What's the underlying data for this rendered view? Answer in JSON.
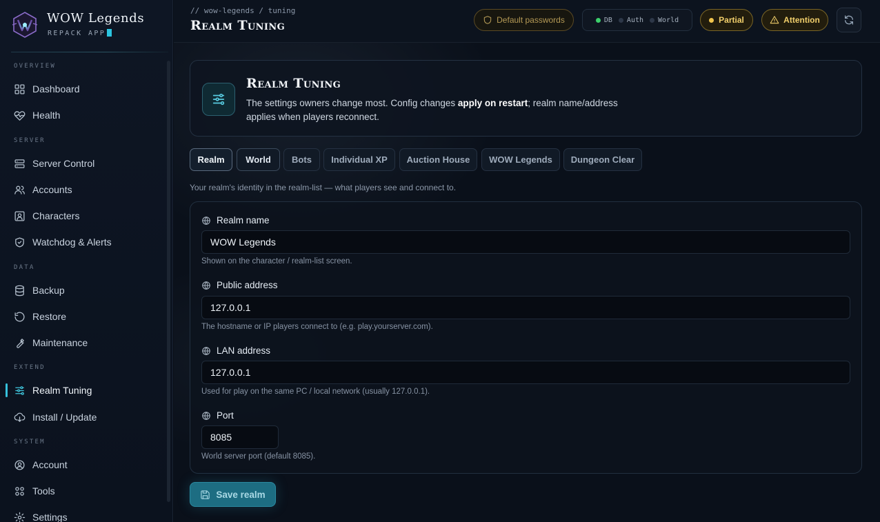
{
  "brand": {
    "title": "WOW Legends",
    "subtitle": "REPACK APP"
  },
  "sidebar": {
    "sections": [
      {
        "label": "OVERVIEW"
      },
      {
        "label": "SERVER"
      },
      {
        "label": "DATA"
      },
      {
        "label": "EXTEND"
      },
      {
        "label": "SYSTEM"
      }
    ],
    "items": [
      {
        "label": "Dashboard",
        "icon": "dashboard-icon"
      },
      {
        "label": "Health",
        "icon": "heart-pulse-icon"
      },
      {
        "label": "Server Control",
        "icon": "server-icon"
      },
      {
        "label": "Accounts",
        "icon": "users-icon"
      },
      {
        "label": "Characters",
        "icon": "character-icon"
      },
      {
        "label": "Watchdog & Alerts",
        "icon": "shield-check-icon"
      },
      {
        "label": "Backup",
        "icon": "database-icon"
      },
      {
        "label": "Restore",
        "icon": "restore-icon"
      },
      {
        "label": "Maintenance",
        "icon": "wrench-icon"
      },
      {
        "label": "Realm Tuning",
        "icon": "sliders-icon",
        "active": true
      },
      {
        "label": "Install / Update",
        "icon": "install-icon"
      },
      {
        "label": "Account",
        "icon": "user-circle-icon"
      },
      {
        "label": "Tools",
        "icon": "tools-icon"
      },
      {
        "label": "Settings",
        "icon": "gear-icon"
      }
    ]
  },
  "topbar": {
    "breadcrumb": "// wow-legends / tuning",
    "title": "Realm Tuning",
    "default_passwords": "Default passwords",
    "status": {
      "db": "DB",
      "auth": "Auth",
      "world": "World"
    },
    "partial": "Partial",
    "attention": "Attention"
  },
  "hero": {
    "title": "Realm Tuning",
    "desc_before": "The settings owners change most. Config changes ",
    "desc_bold": "apply on restart",
    "desc_after": "; realm name/address applies when players reconnect."
  },
  "tabs": [
    "Realm",
    "World",
    "Bots",
    "Individual XP",
    "Auction House",
    "WOW Legends",
    "Dungeon Clear"
  ],
  "tab_hint": "Your realm's identity in the realm-list — what players see and connect to.",
  "form": {
    "realm_name": {
      "label": "Realm name",
      "value": "WOW Legends",
      "help": "Shown on the character / realm-list screen."
    },
    "public_address": {
      "label": "Public address",
      "value": "127.0.0.1",
      "help": "The hostname or IP players connect to (e.g. play.yourserver.com)."
    },
    "lan_address": {
      "label": "LAN address",
      "value": "127.0.0.1",
      "help": "Used for play on the same PC / local network (usually 127.0.0.1)."
    },
    "port": {
      "label": "Port",
      "value": "8085",
      "help": "World server port (default 8085)."
    }
  },
  "save_label": "Save realm",
  "colors": {
    "accent": "#36c2dc",
    "warning": "#f1cf6b",
    "ok": "#3ccf6b",
    "bg": "#0a101a"
  }
}
